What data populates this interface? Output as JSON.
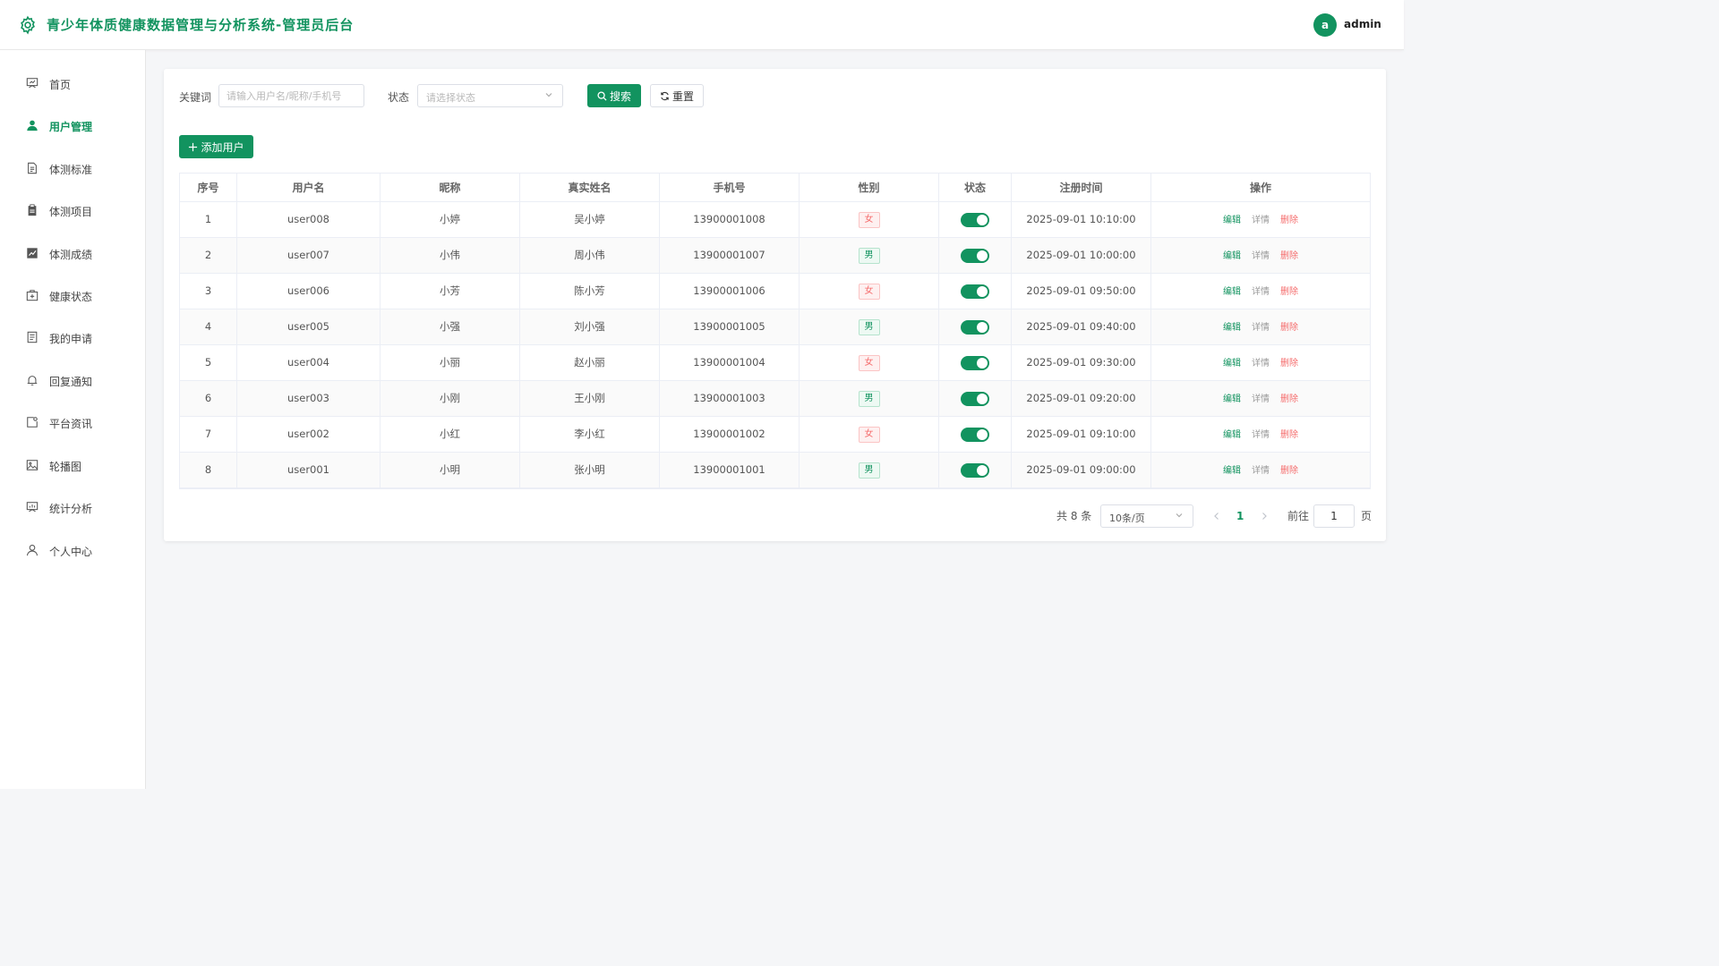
{
  "header": {
    "title": "青少年体质健康数据管理与分析系统-管理员后台",
    "avatar_letter": "a",
    "user_name": "admin",
    "accent": "#12935f"
  },
  "sidebar": {
    "items": [
      {
        "label": "首页",
        "icon": "dashboard-icon",
        "active": false
      },
      {
        "label": "用户管理",
        "icon": "user-filled-icon",
        "active": true
      },
      {
        "label": "体测标准",
        "icon": "document-icon",
        "active": false
      },
      {
        "label": "体测项目",
        "icon": "clipboard-icon",
        "active": false
      },
      {
        "label": "体测成绩",
        "icon": "chart-icon",
        "active": false
      },
      {
        "label": "健康状态",
        "icon": "medical-box-icon",
        "active": false
      },
      {
        "label": "我的申请",
        "icon": "tickets-icon",
        "active": false
      },
      {
        "label": "回复通知",
        "icon": "bell-icon",
        "active": false
      },
      {
        "label": "平台资讯",
        "icon": "news-icon",
        "active": false
      },
      {
        "label": "轮播图",
        "icon": "picture-icon",
        "active": false
      },
      {
        "label": "统计分析",
        "icon": "presentation-icon",
        "active": false
      },
      {
        "label": "个人中心",
        "icon": "user-icon",
        "active": false
      }
    ]
  },
  "search": {
    "keyword_label": "关键词",
    "keyword_placeholder": "请输入用户名/昵称/手机号",
    "status_label": "状态",
    "status_placeholder": "请选择状态",
    "search_button": "搜索",
    "reset_button": "重置"
  },
  "add_button": "添加用户",
  "table": {
    "columns": [
      "序号",
      "用户名",
      "昵称",
      "真实姓名",
      "手机号",
      "性别",
      "状态",
      "注册时间",
      "操作"
    ],
    "rows": [
      {
        "no": "1",
        "username": "user008",
        "nickname": "小婷",
        "realname": "吴小婷",
        "phone": "13900001008",
        "gender": "女",
        "enabled": true,
        "time": "2025-09-01 10:10:00"
      },
      {
        "no": "2",
        "username": "user007",
        "nickname": "小伟",
        "realname": "周小伟",
        "phone": "13900001007",
        "gender": "男",
        "enabled": true,
        "time": "2025-09-01 10:00:00"
      },
      {
        "no": "3",
        "username": "user006",
        "nickname": "小芳",
        "realname": "陈小芳",
        "phone": "13900001006",
        "gender": "女",
        "enabled": true,
        "time": "2025-09-01 09:50:00"
      },
      {
        "no": "4",
        "username": "user005",
        "nickname": "小强",
        "realname": "刘小强",
        "phone": "13900001005",
        "gender": "男",
        "enabled": true,
        "time": "2025-09-01 09:40:00"
      },
      {
        "no": "5",
        "username": "user004",
        "nickname": "小丽",
        "realname": "赵小丽",
        "phone": "13900001004",
        "gender": "女",
        "enabled": true,
        "time": "2025-09-01 09:30:00"
      },
      {
        "no": "6",
        "username": "user003",
        "nickname": "小刚",
        "realname": "王小刚",
        "phone": "13900001003",
        "gender": "男",
        "enabled": true,
        "time": "2025-09-01 09:20:00"
      },
      {
        "no": "7",
        "username": "user002",
        "nickname": "小红",
        "realname": "李小红",
        "phone": "13900001002",
        "gender": "女",
        "enabled": true,
        "time": "2025-09-01 09:10:00"
      },
      {
        "no": "8",
        "username": "user001",
        "nickname": "小明",
        "realname": "张小明",
        "phone": "13900001001",
        "gender": "男",
        "enabled": true,
        "time": "2025-09-01 09:00:00"
      }
    ],
    "ops": {
      "edit": "编辑",
      "detail": "详情",
      "delete": "删除"
    }
  },
  "pagination": {
    "total_text": "共 8 条",
    "page_size": "10条/页",
    "current_page": "1",
    "goto_label": "前往",
    "goto_value": "1",
    "page_suffix": "页"
  }
}
